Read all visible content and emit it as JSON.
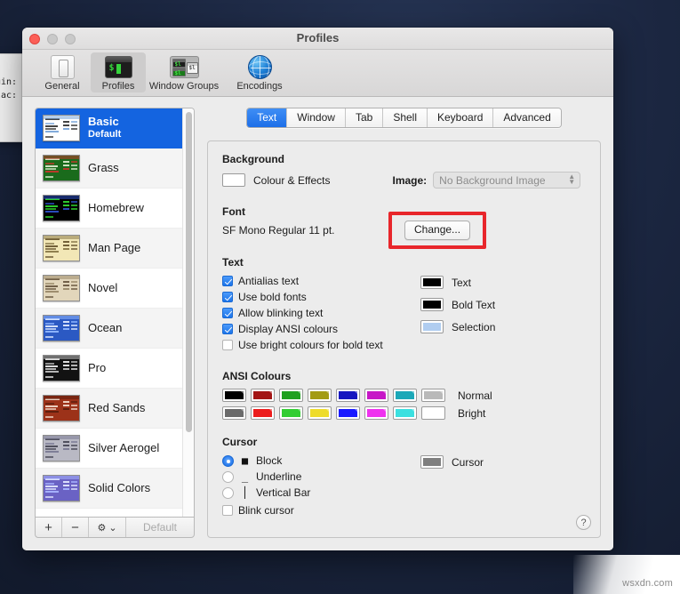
{
  "desktop": {
    "background_color": "#1b2640",
    "background_terminal": {
      "line1": "gin:",
      "line2": "lac:"
    },
    "watermark": "wsxdn.com"
  },
  "window": {
    "title": "Profiles",
    "traffic_lights": [
      "close-button",
      "minimize-button",
      "maximize-button"
    ]
  },
  "toolbar": {
    "items": [
      {
        "label": "General",
        "icon": "general-switch-icon",
        "active": false
      },
      {
        "label": "Profiles",
        "icon": "terminal-icon",
        "active": true
      },
      {
        "label": "Window Groups",
        "icon": "window-groups-icon",
        "active": false
      },
      {
        "label": "Encodings",
        "icon": "globe-icon",
        "active": false
      }
    ]
  },
  "sidebar": {
    "profiles": [
      {
        "name": "Basic",
        "subtitle": "Default",
        "selected": true,
        "bg": "#ffffff",
        "fg": "#3a3a3a",
        "accent": "#7ba7d9"
      },
      {
        "name": "Grass",
        "subtitle": "",
        "selected": false,
        "bg": "#1a6b1c",
        "fg": "#d8e8c8",
        "accent": "#c0392b"
      },
      {
        "name": "Homebrew",
        "subtitle": "",
        "selected": false,
        "bg": "#000000",
        "fg": "#2fd32f",
        "accent": "#2b4fc4"
      },
      {
        "name": "Man Page",
        "subtitle": "",
        "selected": false,
        "bg": "#f2e7b6",
        "fg": "#6b5a33",
        "accent": "#8a7a4a"
      },
      {
        "name": "Novel",
        "subtitle": "",
        "selected": false,
        "bg": "#e2d6bb",
        "fg": "#6b5a42",
        "accent": "#9a8a6a"
      },
      {
        "name": "Ocean",
        "subtitle": "",
        "selected": false,
        "bg": "#2b59c3",
        "fg": "#dbe7ff",
        "accent": "#8fb6ff"
      },
      {
        "name": "Pro",
        "subtitle": "",
        "selected": false,
        "bg": "#121212",
        "fg": "#e8e8e8",
        "accent": "#bdbdbd"
      },
      {
        "name": "Red Sands",
        "subtitle": "",
        "selected": false,
        "bg": "#9c3219",
        "fg": "#f0d7c8",
        "accent": "#5c1d0d"
      },
      {
        "name": "Silver Aerogel",
        "subtitle": "",
        "selected": false,
        "bg": "#b9b9c4",
        "fg": "#4a4a58",
        "accent": "#7b7b95"
      },
      {
        "name": "Solid Colors",
        "subtitle": "",
        "selected": false,
        "bg": "#6a62c4",
        "fg": "#dfe4ff",
        "accent": "#a8b4ff"
      }
    ],
    "bottom_toolbar": {
      "add": "+",
      "remove": "−",
      "gear": "⚙",
      "gear_chevron": "⌄",
      "default_label": "Default"
    }
  },
  "panel": {
    "tabs": [
      {
        "label": "Text",
        "active": true
      },
      {
        "label": "Window",
        "active": false
      },
      {
        "label": "Tab",
        "active": false
      },
      {
        "label": "Shell",
        "active": false
      },
      {
        "label": "Keyboard",
        "active": false
      },
      {
        "label": "Advanced",
        "active": false
      }
    ],
    "background": {
      "section_title": "Background",
      "colour_effects_label": "Colour & Effects",
      "colour_effects_swatch": "#ffffff",
      "image_label": "Image:",
      "image_value": "No Background Image"
    },
    "font": {
      "section_title": "Font",
      "value": "SF Mono Regular 11 pt.",
      "change_button": "Change...",
      "highlight_color": "#e8262b"
    },
    "text": {
      "section_title": "Text",
      "checkboxes": [
        {
          "label": "Antialias text",
          "checked": true
        },
        {
          "label": "Use bold fonts",
          "checked": true
        },
        {
          "label": "Allow blinking text",
          "checked": true
        },
        {
          "label": "Display ANSI colours",
          "checked": true
        },
        {
          "label": "Use bright colours for bold text",
          "checked": false
        }
      ],
      "colour_wells": [
        {
          "label": "Text",
          "color": "#000000"
        },
        {
          "label": "Bold Text",
          "color": "#000000"
        },
        {
          "label": "Selection",
          "color": "#b0cdf0"
        }
      ]
    },
    "ansi": {
      "section_title": "ANSI Colours",
      "rows": [
        {
          "label": "Normal",
          "colors": [
            "#000000",
            "#a31515",
            "#1fa11f",
            "#a39b12",
            "#1616c0",
            "#c717c7",
            "#1aa8b8",
            "#b9b9b9"
          ]
        },
        {
          "label": "Bright",
          "colors": [
            "#6b6b6b",
            "#ec1c1c",
            "#32cd32",
            "#eedc2b",
            "#1a1aff",
            "#ef31ef",
            "#3be0e0",
            "#ffffff"
          ]
        }
      ]
    },
    "cursor": {
      "section_title": "Cursor",
      "options": [
        {
          "label": "Block",
          "glyph": "■",
          "selected": true
        },
        {
          "label": "Underline",
          "glyph": "_",
          "selected": false
        },
        {
          "label": "Vertical Bar",
          "glyph": "│",
          "selected": false
        }
      ],
      "blink_label": "Blink cursor",
      "blink_checked": false,
      "colour_well": {
        "label": "Cursor",
        "color": "#7f7f7f"
      }
    },
    "help_button": "?"
  }
}
